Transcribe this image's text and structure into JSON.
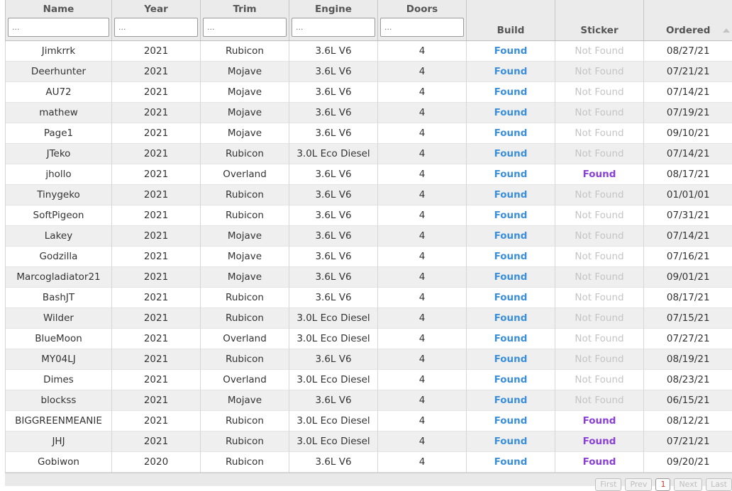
{
  "columns": {
    "name": "Name",
    "year": "Year",
    "trim": "Trim",
    "engine": "Engine",
    "doors": "Doors",
    "build": "Build",
    "sticker": "Sticker",
    "ordered": "Ordered"
  },
  "filters": {
    "name": "...",
    "year": "...",
    "trim": "...",
    "engine": "...",
    "doors": "..."
  },
  "rows": [
    {
      "name": "Jimkrrk",
      "year": "2021",
      "trim": "Rubicon",
      "engine": "3.6L V6",
      "doors": "4",
      "build": "Found",
      "sticker": "Not Found",
      "ordered": "08/27/21"
    },
    {
      "name": "Deerhunter",
      "year": "2021",
      "trim": "Mojave",
      "engine": "3.6L V6",
      "doors": "4",
      "build": "Found",
      "sticker": "Not Found",
      "ordered": "07/21/21"
    },
    {
      "name": "AU72",
      "year": "2021",
      "trim": "Mojave",
      "engine": "3.6L V6",
      "doors": "4",
      "build": "Found",
      "sticker": "Not Found",
      "ordered": "07/14/21"
    },
    {
      "name": "mathew",
      "year": "2021",
      "trim": "Mojave",
      "engine": "3.6L V6",
      "doors": "4",
      "build": "Found",
      "sticker": "Not Found",
      "ordered": "07/19/21"
    },
    {
      "name": "Page1",
      "year": "2021",
      "trim": "Mojave",
      "engine": "3.6L V6",
      "doors": "4",
      "build": "Found",
      "sticker": "Not Found",
      "ordered": "09/10/21"
    },
    {
      "name": "JTeko",
      "year": "2021",
      "trim": "Rubicon",
      "engine": "3.0L Eco Diesel",
      "doors": "4",
      "build": "Found",
      "sticker": "Not Found",
      "ordered": "07/14/21"
    },
    {
      "name": "jhollo",
      "year": "2021",
      "trim": "Overland",
      "engine": "3.6L V6",
      "doors": "4",
      "build": "Found",
      "sticker": "Found",
      "ordered": "08/17/21"
    },
    {
      "name": "Tinygeko",
      "year": "2021",
      "trim": "Rubicon",
      "engine": "3.6L V6",
      "doors": "4",
      "build": "Found",
      "sticker": "Not Found",
      "ordered": "01/01/01"
    },
    {
      "name": "SoftPigeon",
      "year": "2021",
      "trim": "Rubicon",
      "engine": "3.6L V6",
      "doors": "4",
      "build": "Found",
      "sticker": "Not Found",
      "ordered": "07/31/21"
    },
    {
      "name": "Lakey",
      "year": "2021",
      "trim": "Mojave",
      "engine": "3.6L V6",
      "doors": "4",
      "build": "Found",
      "sticker": "Not Found",
      "ordered": "07/14/21"
    },
    {
      "name": "Godzilla",
      "year": "2021",
      "trim": "Mojave",
      "engine": "3.6L V6",
      "doors": "4",
      "build": "Found",
      "sticker": "Not Found",
      "ordered": "07/16/21"
    },
    {
      "name": "Marcogladiator21",
      "year": "2021",
      "trim": "Mojave",
      "engine": "3.6L V6",
      "doors": "4",
      "build": "Found",
      "sticker": "Not Found",
      "ordered": "09/01/21"
    },
    {
      "name": "BashJT",
      "year": "2021",
      "trim": "Rubicon",
      "engine": "3.6L V6",
      "doors": "4",
      "build": "Found",
      "sticker": "Not Found",
      "ordered": "08/17/21"
    },
    {
      "name": "Wilder",
      "year": "2021",
      "trim": "Rubicon",
      "engine": "3.0L Eco Diesel",
      "doors": "4",
      "build": "Found",
      "sticker": "Not Found",
      "ordered": "07/15/21"
    },
    {
      "name": "BlueMoon",
      "year": "2021",
      "trim": "Overland",
      "engine": "3.0L Eco Diesel",
      "doors": "4",
      "build": "Found",
      "sticker": "Not Found",
      "ordered": "07/27/21"
    },
    {
      "name": "MY04LJ",
      "year": "2021",
      "trim": "Rubicon",
      "engine": "3.6L V6",
      "doors": "4",
      "build": "Found",
      "sticker": "Not Found",
      "ordered": "08/19/21"
    },
    {
      "name": "Dimes",
      "year": "2021",
      "trim": "Overland",
      "engine": "3.0L Eco Diesel",
      "doors": "4",
      "build": "Found",
      "sticker": "Not Found",
      "ordered": "08/23/21"
    },
    {
      "name": "blockss",
      "year": "2021",
      "trim": "Mojave",
      "engine": "3.6L V6",
      "doors": "4",
      "build": "Found",
      "sticker": "Not Found",
      "ordered": "06/15/21"
    },
    {
      "name": "BIGGREENMEANIE",
      "year": "2021",
      "trim": "Rubicon",
      "engine": "3.0L Eco Diesel",
      "doors": "4",
      "build": "Found",
      "sticker": "Found",
      "ordered": "08/12/21"
    },
    {
      "name": "JHJ",
      "year": "2021",
      "trim": "Rubicon",
      "engine": "3.0L Eco Diesel",
      "doors": "4",
      "build": "Found",
      "sticker": "Found",
      "ordered": "07/21/21"
    },
    {
      "name": "Gobiwon",
      "year": "2020",
      "trim": "Rubicon",
      "engine": "3.6L V6",
      "doors": "4",
      "build": "Found",
      "sticker": "Found",
      "ordered": "09/20/21"
    }
  ],
  "pagination": {
    "first": "First",
    "prev": "Prev",
    "current": "1",
    "next": "Next",
    "last": "Last"
  },
  "colors": {
    "build_found": "#3b8fd9",
    "sticker_found": "#8a3fd8",
    "not_found": "#c4c4c4",
    "header_bg": "#ebebeb",
    "stripe_bg": "#efefef"
  },
  "sort": {
    "column": "ordered",
    "direction": "ascending",
    "icon": "sort-ascending-icon"
  }
}
